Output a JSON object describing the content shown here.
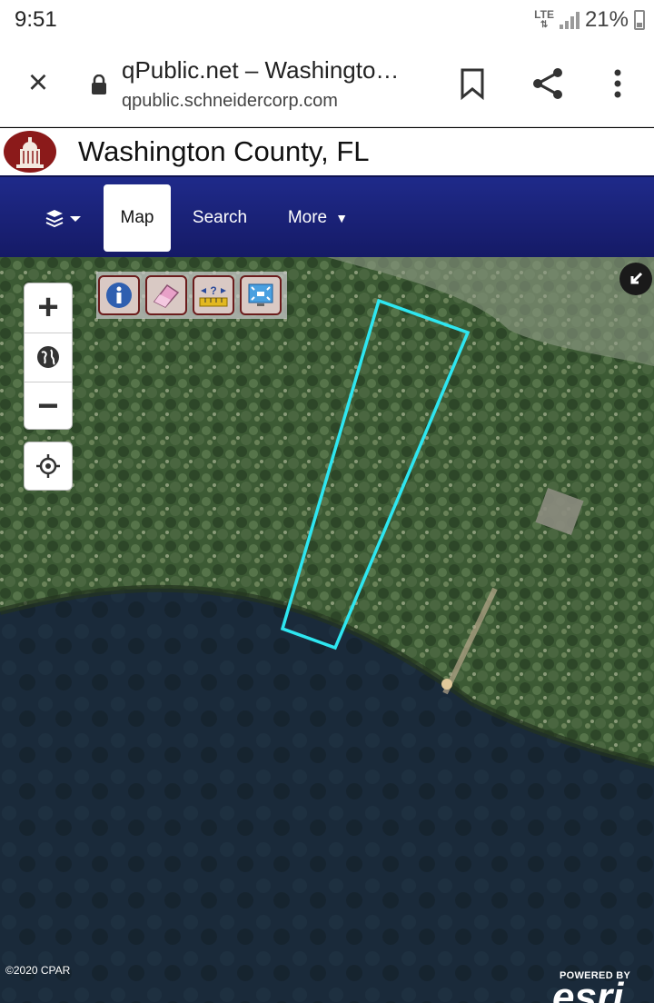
{
  "status_bar": {
    "time": "9:51",
    "network": "LTE",
    "battery": "21%"
  },
  "browser": {
    "page_title": "qPublic.net – Washingto…",
    "host": "qpublic.schneidercorp.com",
    "icons": [
      "close-icon",
      "lock-icon",
      "bookmark-icon",
      "share-icon",
      "more-vert-icon"
    ]
  },
  "header": {
    "title": "Washington County, FL"
  },
  "nav": {
    "tabs": [
      {
        "label": "Map",
        "active": true
      },
      {
        "label": "Search",
        "active": false
      },
      {
        "label": "More",
        "active": false
      }
    ]
  },
  "map": {
    "controls": [
      "zoom-in-icon",
      "globe-icon",
      "zoom-out-icon",
      "locate-icon"
    ],
    "tools": [
      "info-icon",
      "eraser-icon",
      "measure-icon",
      "fullscreen-extent-icon"
    ],
    "parcel_color": "#2ee6f0",
    "copyright": "©2020 CPAR",
    "powered_by": "POWERED BY",
    "esri": "esri"
  },
  "colors": {
    "nav_bg": "#1b237a",
    "seal": "#8b1a1a",
    "tool_border": "#6b1c1c"
  }
}
